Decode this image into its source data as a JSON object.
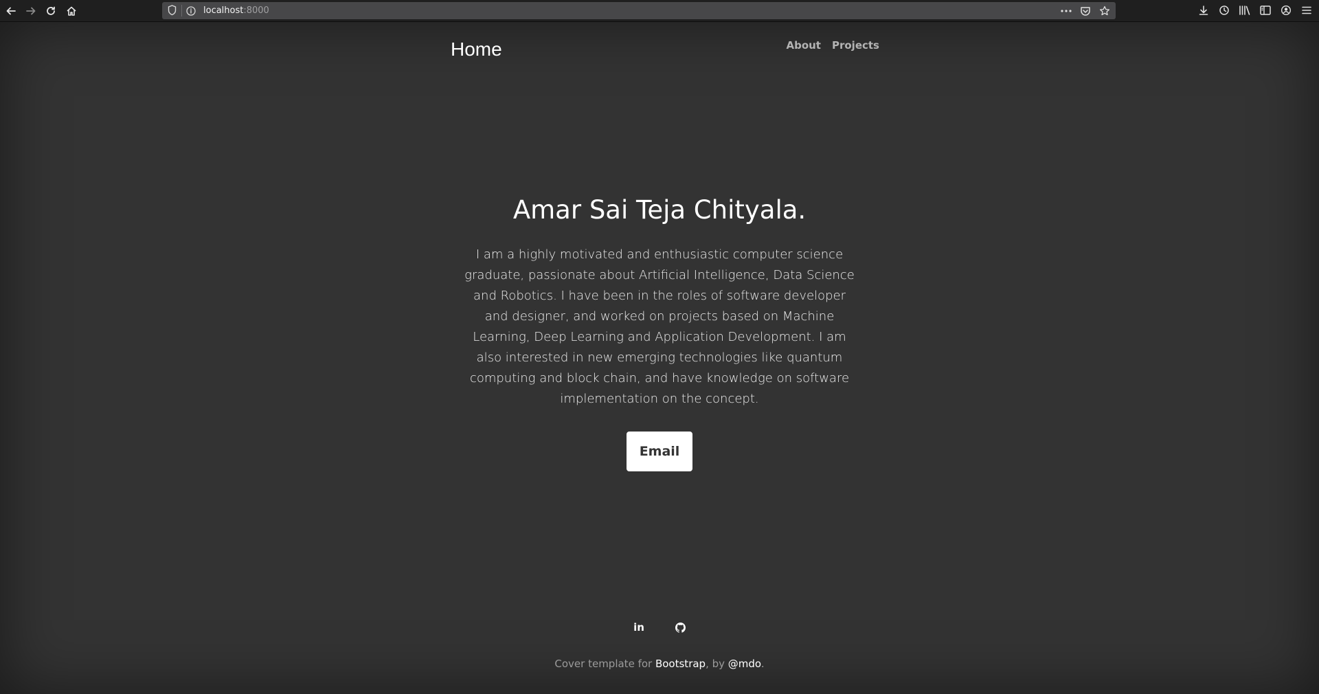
{
  "browser": {
    "url_host": "localhost",
    "url_port": ":8000"
  },
  "nav": {
    "brand": "Home",
    "links": [
      "About",
      "Projects"
    ]
  },
  "hero": {
    "title": "Amar Sai Teja Chityala.",
    "description": "I am a highly motivated and enthusiastic computer science graduate, passionate about Artificial Intelligence, Data Science and Robotics. I have been in the roles of software developer and designer, and worked on projects based on Machine Learning, Deep Learning and Application Development. I am also interested in new emerging technologies like quantum computing and block chain, and have knowledge on software implementation on the concept.",
    "button_label": "Email"
  },
  "social": {
    "linkedin_label": "in"
  },
  "footer": {
    "prefix": "Cover template for ",
    "bootstrap_link": "Bootstrap",
    "middle": ", by ",
    "author_link": "@mdo",
    "suffix": "."
  },
  "colors": {
    "page_background": "#333333",
    "chrome_background": "#1f1f1f",
    "url_field": "#474749",
    "nav_link": "#b3b3b3",
    "footer_text": "#9b9b9b"
  },
  "icons": {
    "toolbar_left": [
      "back-arrow-icon",
      "forward-arrow-icon",
      "reload-icon",
      "home-icon"
    ],
    "url_bar": [
      "shield-icon",
      "info-icon",
      "more-dots-icon",
      "pocket-icon",
      "star-icon"
    ],
    "toolbar_right": [
      "download-icon",
      "history-icon",
      "library-icon",
      "sidebar-icon",
      "account-icon",
      "menu-icon"
    ],
    "social": [
      "linkedin-icon",
      "github-icon"
    ]
  }
}
